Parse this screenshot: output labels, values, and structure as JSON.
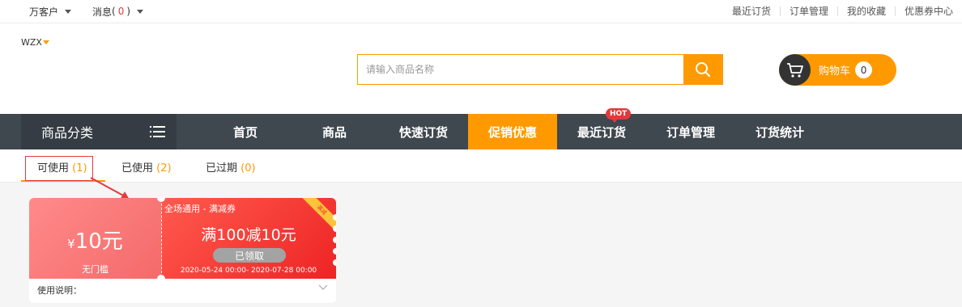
{
  "topbar": {
    "account_label": "万客户",
    "messages_label": "消息",
    "messages_count": "0",
    "links": [
      "最近订货",
      "订单管理",
      "我的收藏",
      "优惠券中心"
    ]
  },
  "header": {
    "username": "WZX",
    "search_placeholder": "请输入商品名称",
    "cart_label": "购物车",
    "cart_count": "0"
  },
  "nav": {
    "category_label": "商品分类",
    "items": [
      "首页",
      "商品",
      "快速订货",
      "促销优惠",
      "最近订货",
      "订单管理",
      "订货统计"
    ],
    "active_index": 3,
    "hot_badge": "HOT"
  },
  "tabs": [
    {
      "label": "可使用",
      "count": "(1)"
    },
    {
      "label": "已使用",
      "count": "(2)"
    },
    {
      "label": "已过期",
      "count": "(0)"
    }
  ],
  "coupon": {
    "currency_symbol": "¥",
    "amount": "10元",
    "threshold": "无门槛",
    "scope": "全场通用 - 满减券",
    "rule": "满100减10元",
    "status_button": "已领取",
    "validity": "2020-05-24 00:00- 2020-07-28 00:00",
    "badge_text": "满减",
    "usage_label": "使用说明："
  },
  "colors": {
    "accent": "#ff9900",
    "nav_bg": "#3f474f",
    "coupon_red": "#ee2424",
    "badge_red": "#e4393c"
  }
}
